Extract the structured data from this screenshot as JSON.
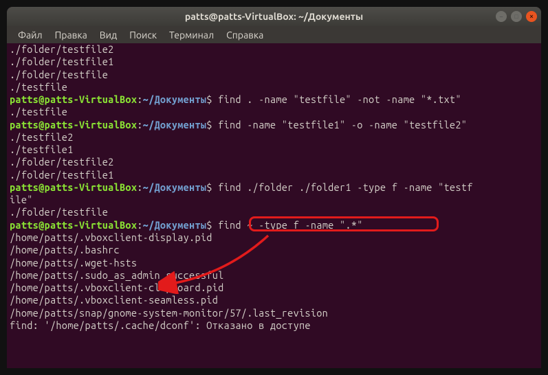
{
  "window": {
    "title": "patts@patts-VirtualBox: ~/Документы"
  },
  "menu": {
    "file": "Файл",
    "edit": "Правка",
    "view": "Вид",
    "search": "Поиск",
    "terminal": "Терминал",
    "help": "Справка"
  },
  "prompt": {
    "user": "patts@patts-VirtualBox",
    "colon": ":",
    "path": "~/Документы",
    "symbol": "$"
  },
  "lines": {
    "l0": "./folder/testfile2",
    "l1": "./folder/testfile1",
    "l2": "./folder/testfile",
    "l3": "./testfile",
    "c1": " find . -name \"testfile\" -not -name \"*.txt\"",
    "l5": "./testfile",
    "c2": " find -name \"testfile1\" -o -name \"testfile2\"",
    "l7": "./testfile2",
    "l8": "./testfile1",
    "l9": "./folder/testfile2",
    "l10": "./folder/testfile1",
    "c3": " find ./folder ./folder1 -type f -name \"testf",
    "c3b": "ile\"",
    "l13": "./folder/testfile",
    "c4": " find ~ -type f -name \".*\"",
    "l15": "/home/patts/.vboxclient-display.pid",
    "l16": "/home/patts/.bashrc",
    "l17": "/home/patts/.wget-hsts",
    "l18": "/home/patts/.sudo_as_admin_successful",
    "l19": "/home/patts/.vboxclient-clipboard.pid",
    "l20": "/home/patts/.vboxclient-seamless.pid",
    "l21": "/home/patts/snap/gnome-system-monitor/57/.last_revision",
    "l22": "find: '/home/patts/.cache/dconf': Отказано в доступе"
  }
}
